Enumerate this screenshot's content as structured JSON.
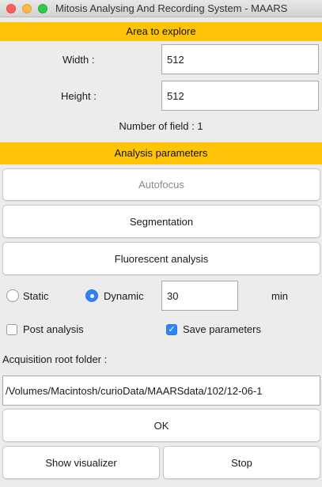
{
  "window": {
    "title": "Mitosis Analysing And Recording System - MAARS"
  },
  "area": {
    "header": "Area to explore",
    "width_label": "Width :",
    "width_value": "512",
    "height_label": "Height :",
    "height_value": "512",
    "fields_count": "Number of field : 1"
  },
  "analysis": {
    "header": "Analysis parameters",
    "autofocus_label": "Autofocus",
    "segmentation_label": "Segmentation",
    "fluorescent_label": "Fluorescent analysis",
    "static_label": "Static",
    "dynamic_label": "Dynamic",
    "duration_value": "30",
    "duration_unit": "min",
    "post_analysis_label": "Post analysis",
    "post_analysis_checked": false,
    "save_parameters_label": "Save parameters",
    "save_parameters_checked": true,
    "mode_selected": "Dynamic"
  },
  "acquisition": {
    "root_label": "Acquisition root folder :",
    "root_path": "/Volumes/Macintosh/curioData/MAARSdata/102/12-06-1"
  },
  "actions": {
    "ok_label": "OK",
    "show_visualizer_label": "Show visualizer",
    "stop_label": "Stop"
  },
  "colors": {
    "section_header": "#ffc408",
    "accent": "#2f84f5"
  }
}
